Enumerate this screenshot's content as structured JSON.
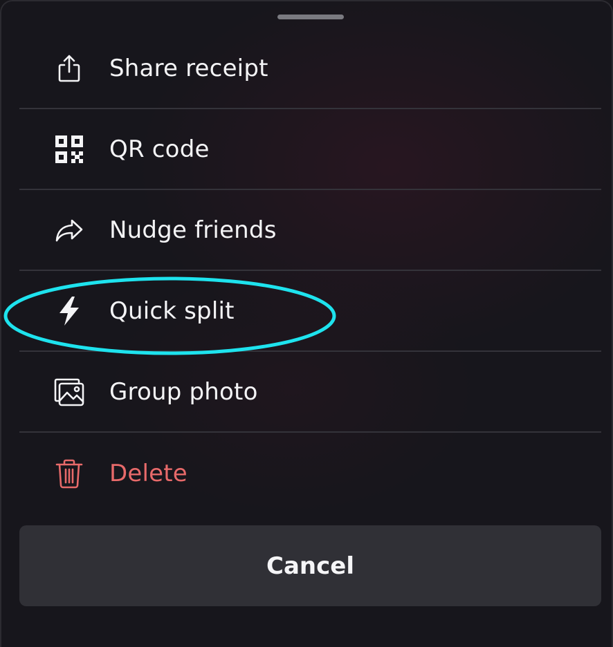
{
  "sheet": {
    "items": [
      {
        "id": "share-receipt",
        "label": "Share receipt",
        "icon": "share-icon"
      },
      {
        "id": "qr-code",
        "label": "QR code",
        "icon": "qr-code-icon"
      },
      {
        "id": "nudge-friends",
        "label": "Nudge friends",
        "icon": "forward-arrow-icon"
      },
      {
        "id": "quick-split",
        "label": "Quick split",
        "icon": "lightning-bolt-icon"
      },
      {
        "id": "group-photo",
        "label": "Group photo",
        "icon": "photo-gallery-icon"
      },
      {
        "id": "delete",
        "label": "Delete",
        "icon": "trash-icon"
      }
    ],
    "cancel_label": "Cancel"
  },
  "colors": {
    "background": "#17161c",
    "text": "#f4f4f6",
    "danger": "#e86a6a",
    "cancel_background": "#303036",
    "highlight": "#1ee3ee",
    "divider": "#34333a"
  },
  "annotation": {
    "highlighted_item": "quick-split",
    "shape": "ellipse"
  }
}
